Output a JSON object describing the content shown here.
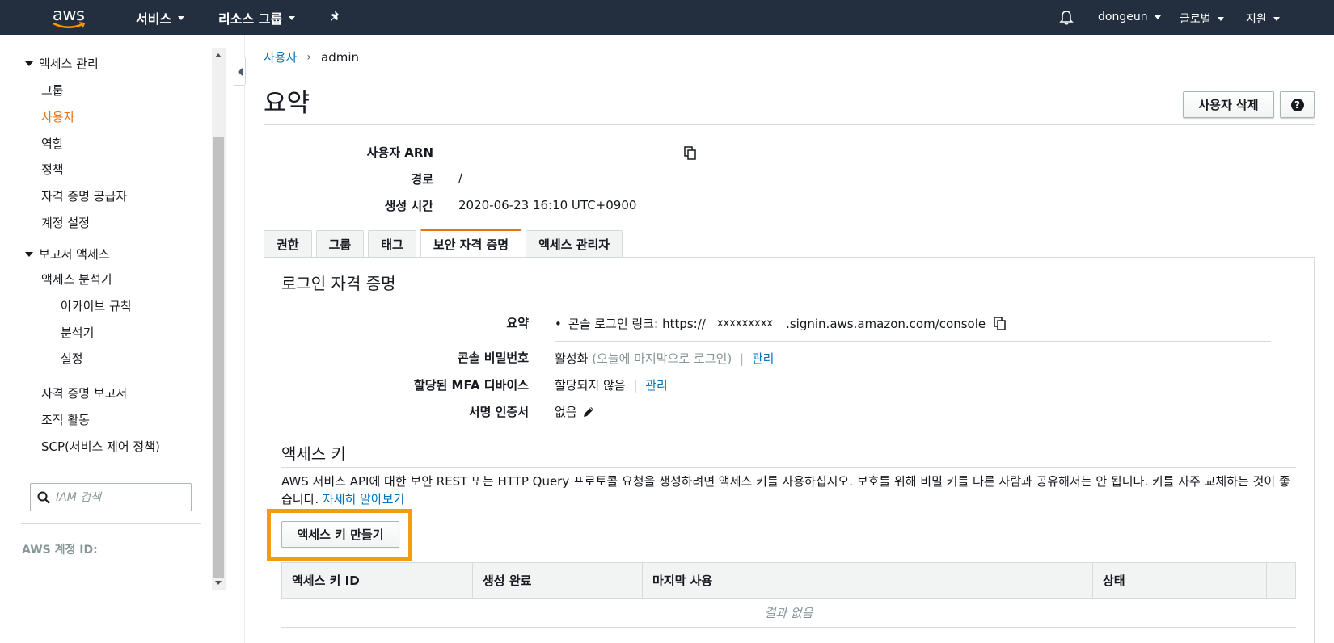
{
  "topnav": {
    "logo": "aws",
    "services": "서비스",
    "resource_groups": "리소스 그룹",
    "user": "dongeun",
    "region": "글로벌",
    "support": "지원"
  },
  "sidebar": {
    "section_access": "액세스 관리",
    "items_access": [
      "그룹",
      "사용자",
      "역할",
      "정책",
      "자격 증명 공급자",
      "계정 설정"
    ],
    "active_item": "사용자",
    "section_reports": "보고서 액세스",
    "analyzer": "액세스 분석기",
    "analyzer_items": [
      "아카이브 규칙",
      "분석기",
      "설정"
    ],
    "credential_report": "자격 증명 보고서",
    "org_activity": "조직 활동",
    "scp": "SCP(서비스 제어 정책)",
    "search_placeholder": "IAM 검색",
    "account_id_label": "AWS 계정 ID:"
  },
  "breadcrumb": {
    "parent": "사용자",
    "current": "admin"
  },
  "page": {
    "title": "요약",
    "delete_button": "사용자 삭제",
    "help_glyph": "?"
  },
  "summary": {
    "arn_label": "사용자 ARN",
    "arn_value": "",
    "path_label": "경로",
    "path_value": "/",
    "created_label": "생성 시간",
    "created_value": "2020-06-23 16:10 UTC+0900"
  },
  "tabs": [
    "권한",
    "그룹",
    "태그",
    "보안 자격 증명",
    "액세스 관리자"
  ],
  "active_tab": "보안 자격 증명",
  "signin": {
    "title": "로그인 자격 증명",
    "summary_label": "요약",
    "console_link_prefix": "콘솔 로그인 링크:",
    "console_link_https": "https://",
    "console_link_account": "xxxxxxxxx",
    "console_link_suffix": ".signin.aws.amazon.com/console",
    "password_label": "콘솔 비밀번호",
    "password_status": "활성화",
    "password_note": "(오늘에 마지막으로 로그인)",
    "password_manage": "관리",
    "mfa_label": "할당된 MFA 디바이스",
    "mfa_status": "할당되지 않음",
    "mfa_manage": "관리",
    "cert_label": "서명 인증서",
    "cert_value": "없음"
  },
  "access_keys": {
    "title": "액세스 키",
    "description": "AWS 서비스 API에 대한 보안 REST 또는 HTTP Query 프로토콜 요청을 생성하려면 액세스 키를 사용하십시오. 보호를 위해 비밀 키를 다른 사람과 공유해서는 안 됩니다. 키를 자주 교체하는 것이 좋습니다.",
    "learn_more": "자세히 알아보기",
    "create_button": "액세스 키 만들기",
    "columns": [
      "액세스 키 ID",
      "생성 완료",
      "마지막 사용",
      "상태"
    ],
    "empty": "결과 없음"
  },
  "colors": {
    "nav_bg": "#232f3e",
    "accent": "#ec7211",
    "link": "#0073bb",
    "highlight": "#f39c12"
  }
}
